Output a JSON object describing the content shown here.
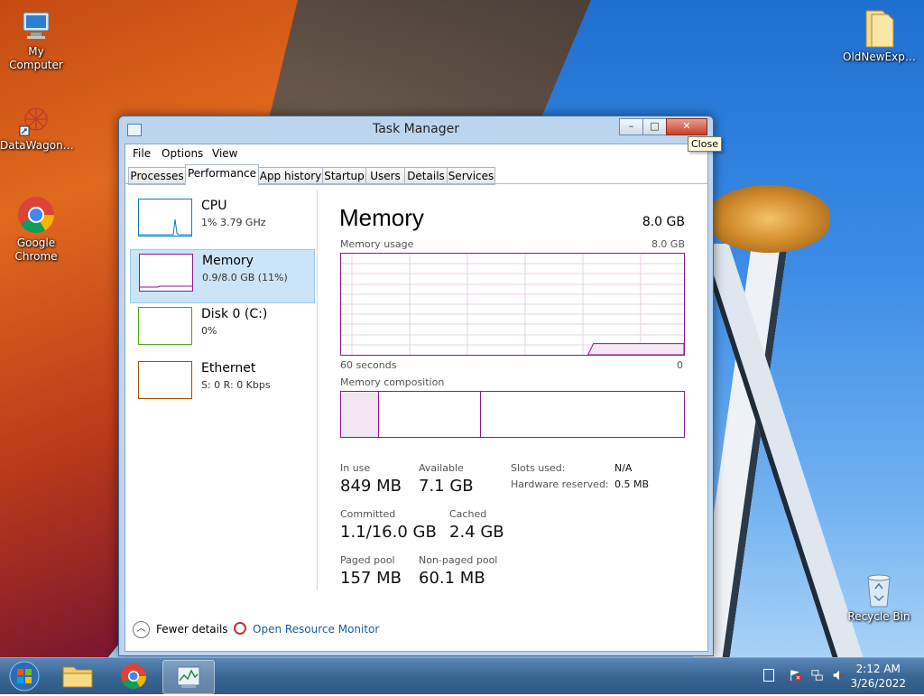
{
  "desktop": {
    "icons": [
      {
        "label": "My Computer"
      },
      {
        "label": "DataWagon…"
      },
      {
        "label": "Google Chrome"
      },
      {
        "label": "OldNewExp…"
      },
      {
        "label": "Recycle Bin"
      }
    ]
  },
  "window": {
    "title": "Task Manager",
    "controls": {
      "minimize": "–",
      "maximize": "□",
      "close": "✕"
    },
    "menu": [
      "File",
      "Options",
      "View"
    ],
    "tabs": [
      "Processes",
      "Performance",
      "App history",
      "Startup",
      "Users",
      "Details",
      "Services"
    ],
    "active_tab": "Performance",
    "resources": [
      {
        "name": "CPU",
        "value": "1%  3.79 GHz",
        "color": "#117dbb"
      },
      {
        "name": "Memory",
        "value": "0.9/8.0 GB (11%)",
        "color": "#8b1a89"
      },
      {
        "name": "Disk 0 (C:)",
        "value": "0%",
        "color": "#4da60c"
      },
      {
        "name": "Ethernet",
        "value": "S: 0  R: 0 Kbps",
        "color": "#a74f01"
      }
    ],
    "detail": {
      "title": "Memory",
      "total": "8.0 GB",
      "usage_label": "Memory usage",
      "usage_max": "8.0 GB",
      "time_label": "60 seconds",
      "time_zero": "0",
      "usage_fraction": 0.11,
      "composition_label": "Memory composition",
      "stats": {
        "in_use": {
          "label": "In use",
          "value": "849 MB"
        },
        "available": {
          "label": "Available",
          "value": "7.1 GB"
        },
        "committed": {
          "label": "Committed",
          "value": "1.1/16.0 GB"
        },
        "cached": {
          "label": "Cached",
          "value": "2.4 GB"
        },
        "paged_pool": {
          "label": "Paged pool",
          "value": "157 MB"
        },
        "non_paged_pool": {
          "label": "Non-paged pool",
          "value": "60.1 MB"
        }
      },
      "kv": [
        {
          "label": "Slots used:",
          "value": "N/A"
        },
        {
          "label": "Hardware reserved:",
          "value": "0.5 MB"
        }
      ]
    },
    "footer": {
      "fewer_details": "Fewer details",
      "resource_monitor": "Open Resource Monitor"
    }
  },
  "tooltip": "Close",
  "taskbar": {
    "time": "2:12 AM",
    "date": "3/26/2022"
  }
}
